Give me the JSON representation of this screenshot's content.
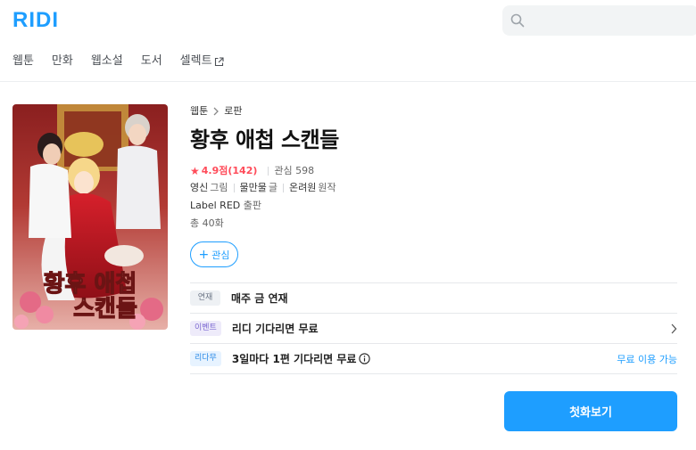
{
  "brand": {
    "logo_text": "RIDI",
    "accent_color": "#1e9eff"
  },
  "search": {
    "placeholder": ""
  },
  "nav": {
    "items": [
      {
        "label": "웹툰"
      },
      {
        "label": "만화"
      },
      {
        "label": "웹소설"
      },
      {
        "label": "도서"
      },
      {
        "label": "셀렉트",
        "external": true
      }
    ]
  },
  "cover": {
    "title_text": "황후 애첩 스캔들",
    "icon": "book-cover-image"
  },
  "breadcrumb": {
    "category": "웹툰",
    "genre": "로판"
  },
  "title": "황후 애첩 스캔들",
  "rating": {
    "score": "4.9점",
    "count": "(142)",
    "fav_label": "관심 598",
    "star_color": "#ff4c5a"
  },
  "authors": [
    {
      "name": "영신",
      "role": "그림"
    },
    {
      "name": "물만물",
      "role": "글"
    },
    {
      "name": "온려원",
      "role": "원작"
    }
  ],
  "publisher": {
    "name": "Label RED",
    "role": "출판"
  },
  "episodes": "총 40화",
  "fav_button": {
    "label": "관심"
  },
  "info_rows": [
    {
      "badge": "연재",
      "text": "매주 금 연재"
    },
    {
      "badge": "이벤트",
      "text": "리디 기다리면 무료"
    },
    {
      "badge": "리다무",
      "text": "3일마다 1편 기다리면 무료",
      "right_text": "무료 이용 가능"
    }
  ],
  "read_button": {
    "label": "첫화보기"
  }
}
